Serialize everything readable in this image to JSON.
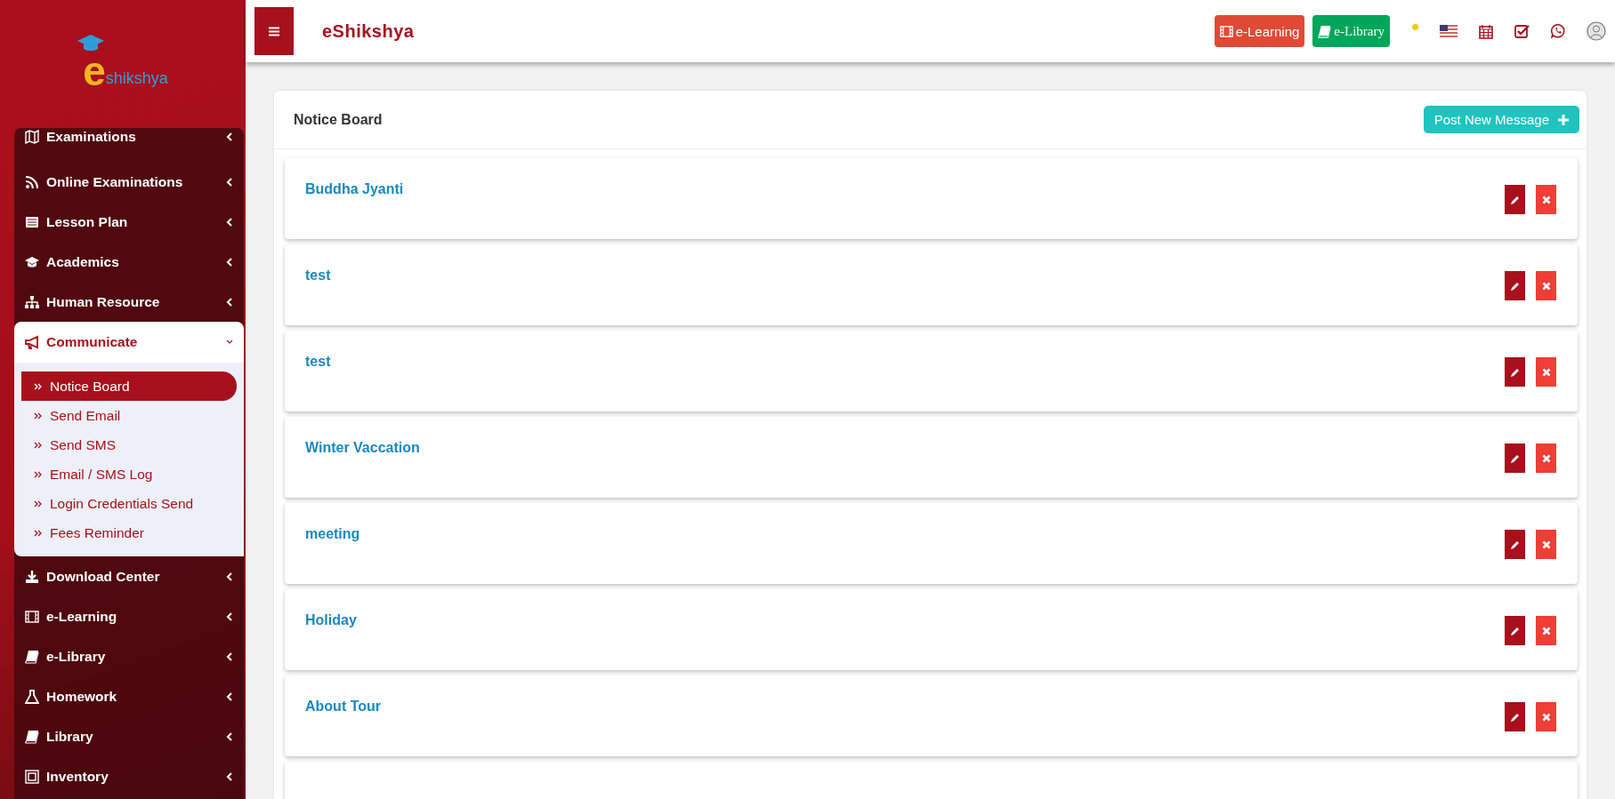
{
  "sidebar": {
    "logo": {
      "letter": "e",
      "text": "shikshya"
    },
    "menu": [
      {
        "label": "Examinations",
        "expanded": false
      },
      {
        "label": "Online Examinations",
        "expanded": false
      },
      {
        "label": "Lesson Plan",
        "expanded": false
      },
      {
        "label": "Academics",
        "expanded": false
      },
      {
        "label": "Human Resource",
        "expanded": false
      },
      {
        "label": "Communicate",
        "expanded": true,
        "children": [
          {
            "label": "Notice Board",
            "selected": true
          },
          {
            "label": "Send Email",
            "selected": false
          },
          {
            "label": "Send SMS",
            "selected": false
          },
          {
            "label": "Email / SMS Log",
            "selected": false
          },
          {
            "label": "Login Credentials Send",
            "selected": false
          },
          {
            "label": "Fees Reminder",
            "selected": false
          }
        ]
      },
      {
        "label": "Download Center",
        "expanded": false
      },
      {
        "label": "e-Learning",
        "expanded": false
      },
      {
        "label": "e-Library",
        "expanded": false
      },
      {
        "label": "Homework",
        "expanded": false
      },
      {
        "label": "Library",
        "expanded": false
      },
      {
        "label": "Inventory",
        "expanded": false
      }
    ]
  },
  "header": {
    "title": "eShikshya",
    "buttons": [
      {
        "label": "e-Learning",
        "kind": "learning"
      },
      {
        "label": "e-Library",
        "kind": "library"
      }
    ]
  },
  "panel": {
    "title": "Notice Board",
    "action": "Post New Message",
    "notices": [
      {
        "title": "Buddha Jyanti"
      },
      {
        "title": "test"
      },
      {
        "title": "test"
      },
      {
        "title": "Winter Vaccation"
      },
      {
        "title": "meeting"
      },
      {
        "title": "Holiday"
      },
      {
        "title": "About Tour"
      }
    ]
  }
}
